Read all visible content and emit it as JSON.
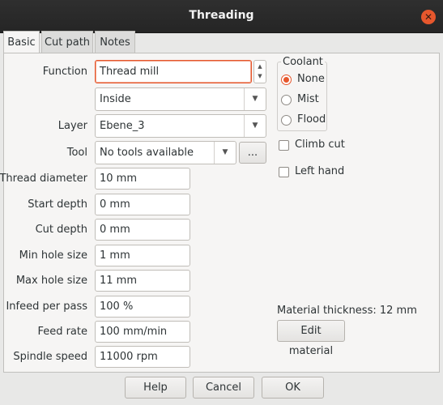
{
  "window": {
    "title": "Threading"
  },
  "tabs": [
    "Basic",
    "Cut path",
    "Notes"
  ],
  "form": {
    "function_label": "Function",
    "function_value": "Thread mill",
    "side_value": "Inside",
    "layer_label": "Layer",
    "layer_value": "Ebene_3",
    "tool_label": "Tool",
    "tool_value": "No tools available",
    "tool_browse": "...",
    "fields": [
      {
        "label": "Thread diameter",
        "value": "10 mm"
      },
      {
        "label": "Start depth",
        "value": "0 mm"
      },
      {
        "label": "Cut depth",
        "value": "0 mm"
      },
      {
        "label": "Min hole size",
        "value": "1 mm"
      },
      {
        "label": "Max hole size",
        "value": "11 mm"
      },
      {
        "label": "Infeed per pass",
        "value": "100 %"
      },
      {
        "label": "Feed rate",
        "value": "100 mm/min"
      },
      {
        "label": "Spindle speed",
        "value": "11000 rpm"
      }
    ]
  },
  "coolant": {
    "title": "Coolant",
    "options": [
      "None",
      "Mist",
      "Flood"
    ],
    "selected": "None"
  },
  "options": {
    "climb_cut": "Climb cut",
    "left_hand": "Left hand"
  },
  "material": {
    "thickness_text": "Material thickness: 12 mm",
    "edit_button": "Edit material"
  },
  "buttons": {
    "help": "Help",
    "cancel": "Cancel",
    "ok": "OK"
  },
  "colors": {
    "accent": "#e6572d",
    "titlebar": "#2b2b2b"
  }
}
